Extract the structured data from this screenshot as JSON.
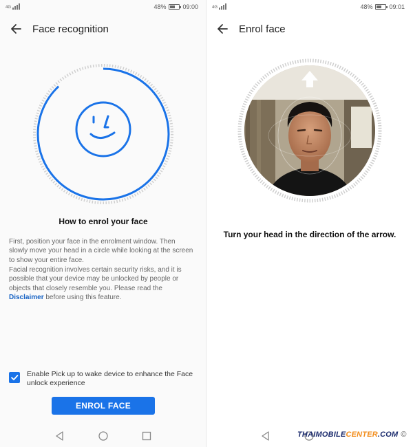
{
  "left_screen": {
    "status": {
      "network": "4G",
      "battery_percent": 48,
      "battery_text": "48%",
      "time": "09:00"
    },
    "title": "Face recognition",
    "heading": "How to enrol your face",
    "paragraph1": "First, position your face in the enrolment window. Then slowly move your head in a circle while looking at the screen to show your entire face.",
    "paragraph2_prefix": "Facial recognition involves certain security risks, and it is possible that your device may be unlocked by people or objects that closely resemble you. Please read the ",
    "disclaimer_link": "Disclaimer",
    "paragraph2_suffix": " before using this feature.",
    "checkbox_label": "Enable Pick up to wake device to enhance the Face unlock experience",
    "checkbox_checked": true,
    "enrol_button": "ENROL FACE",
    "progress_ring_fraction": 0.88
  },
  "right_screen": {
    "status": {
      "network": "4G",
      "battery_percent": 48,
      "battery_text": "48%",
      "time": "09:01"
    },
    "title": "Enrol face",
    "instruction": "Turn your head in the direction of the arrow.",
    "watermark_main": "THAIMOBILE",
    "watermark_accent": "CENTER",
    "watermark_suffix": ".COM",
    "watermark_symbol": "©"
  },
  "colors": {
    "accent": "#1a73e8",
    "link": "#1662c4",
    "ring_track": "#d0d0d0",
    "text_secondary": "#666666"
  },
  "icons": [
    "back-arrow-icon",
    "smile-face-icon",
    "check-icon",
    "up-arrow-icon",
    "nav-back-icon",
    "nav-home-icon",
    "nav-recents-icon"
  ]
}
